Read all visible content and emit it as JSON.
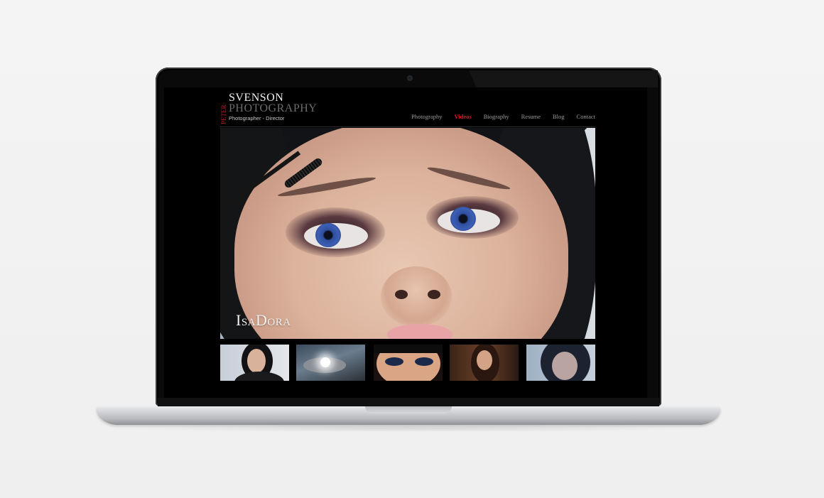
{
  "site": {
    "logo_side": "PETER",
    "logo_main": "SVENSON",
    "logo_sub": "PHOTOGRAPHY",
    "logo_tagline": "Photographer - Director"
  },
  "nav": {
    "items": [
      {
        "label": "Photography",
        "active": false
      },
      {
        "label": "Videos",
        "active": true
      },
      {
        "label": "Biography",
        "active": false
      },
      {
        "label": "Resume",
        "active": false
      },
      {
        "label": "Blog",
        "active": false
      },
      {
        "label": "Contact",
        "active": false
      }
    ]
  },
  "hero": {
    "watermark": "IsaDora"
  },
  "thumbnails": {
    "count": 5
  },
  "colors": {
    "accent": "#e3151d",
    "page_background": "#000000",
    "nav_text": "#9a9a9a"
  }
}
